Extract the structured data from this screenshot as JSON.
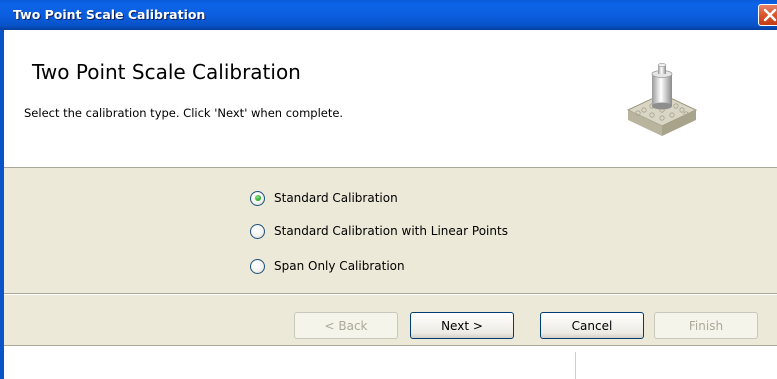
{
  "window": {
    "title": "Two Point Scale Calibration"
  },
  "header": {
    "title": "Two Point Scale Calibration",
    "subtitle": "Select the calibration type. Click 'Next' when complete.",
    "icon": "scale-weight-icon"
  },
  "options": [
    {
      "label": "Standard Calibration",
      "selected": true
    },
    {
      "label": "Standard Calibration with Linear Points",
      "selected": false
    },
    {
      "label": "Span Only Calibration",
      "selected": false
    }
  ],
  "buttons": {
    "back": {
      "label": "< Back",
      "enabled": false
    },
    "next": {
      "label": "Next >",
      "enabled": true
    },
    "cancel": {
      "label": "Cancel",
      "enabled": true
    },
    "finish": {
      "label": "Finish",
      "enabled": false
    }
  },
  "colors": {
    "titlebar": "#0c64e8",
    "close": "#d9542b",
    "radio_checked": "#30b12e"
  }
}
